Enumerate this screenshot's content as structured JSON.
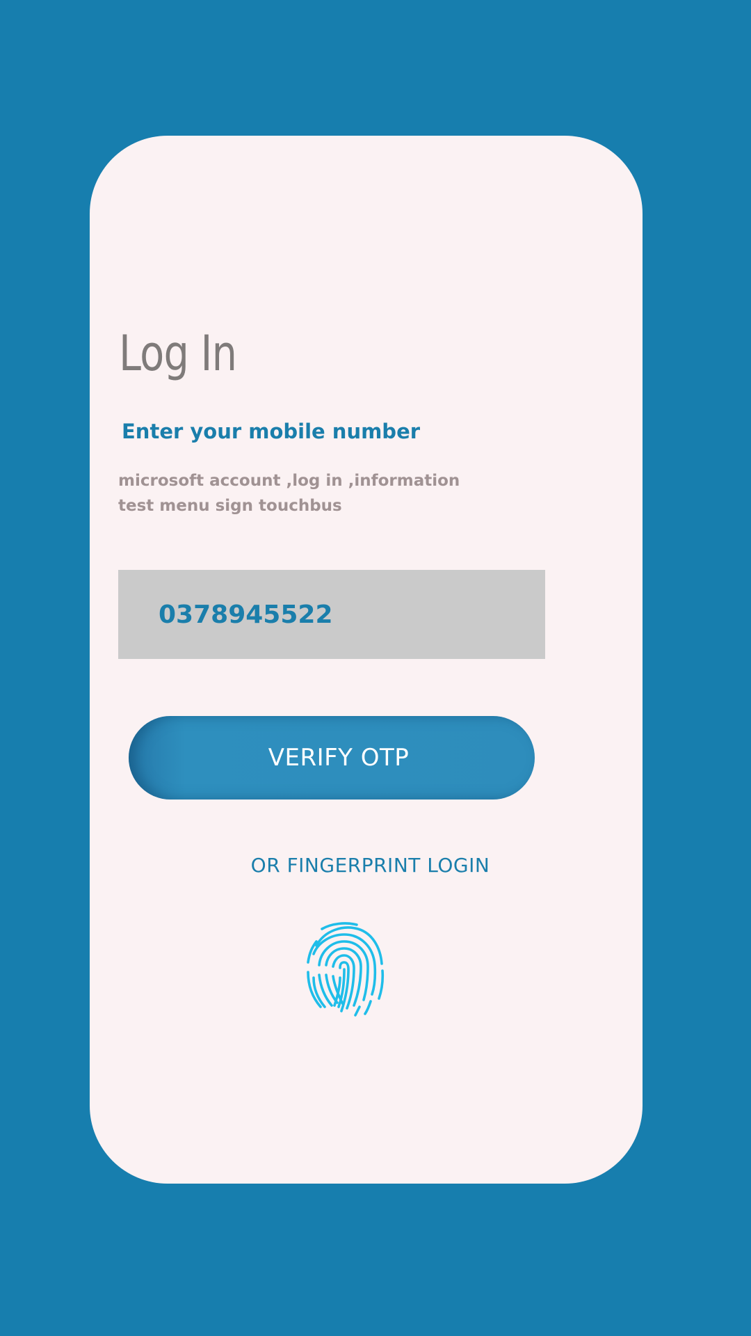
{
  "theme": {
    "background": "#177eae",
    "card": "#fbf2f3",
    "accent": "#1a7eab",
    "muted_text": "#a09293",
    "field": "#cacaca",
    "fingerprint": "#1fbde9"
  },
  "login": {
    "title": "Log In",
    "subtitle": "Enter your mobile number",
    "description": "microsoft account ,log in ,information test menu sign touchbus",
    "phone_value": "0378945522",
    "verify_button_label": "VERIFY OTP",
    "alt_login_label": "OR FINGERPRINT LOGIN",
    "fingerprint_icon": "fingerprint-icon"
  }
}
